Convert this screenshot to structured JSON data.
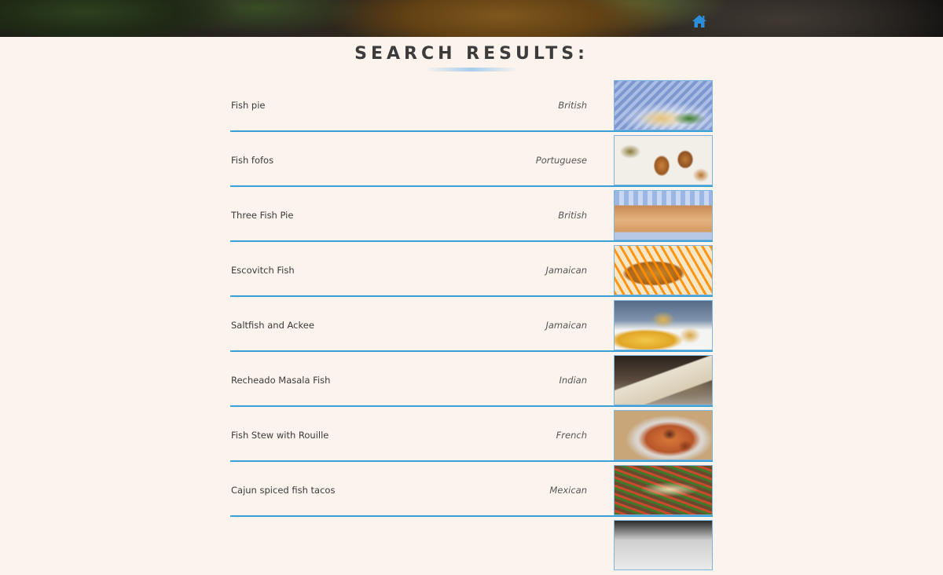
{
  "header": {
    "home_icon": "home-icon",
    "accent_color": "#2a8fd8"
  },
  "page": {
    "title": "SEARCH RESULTS:"
  },
  "results": [
    {
      "name": "Fish pie",
      "cuisine": "British",
      "image": "fish-pie-photo"
    },
    {
      "name": "Fish fofos",
      "cuisine": "Portuguese",
      "image": "fish-fofos-photo"
    },
    {
      "name": "Three Fish Pie",
      "cuisine": "British",
      "image": "three-fish-pie-photo"
    },
    {
      "name": "Escovitch Fish",
      "cuisine": "Jamaican",
      "image": "escovitch-fish-photo"
    },
    {
      "name": "Saltfish and Ackee",
      "cuisine": "Jamaican",
      "image": "saltfish-ackee-photo"
    },
    {
      "name": "Recheado Masala Fish",
      "cuisine": "Indian",
      "image": "recheado-masala-fish-photo"
    },
    {
      "name": "Fish Stew with Rouille",
      "cuisine": "French",
      "image": "fish-stew-rouille-photo"
    },
    {
      "name": "Cajun spiced fish tacos",
      "cuisine": "Mexican",
      "image": "cajun-fish-tacos-photo"
    },
    {
      "name": "",
      "cuisine": "",
      "image": "partial-recipe-photo"
    }
  ],
  "colors": {
    "background": "#fcf4ec",
    "divider": "#3aa0d8",
    "title_text": "#3c3c3c"
  }
}
